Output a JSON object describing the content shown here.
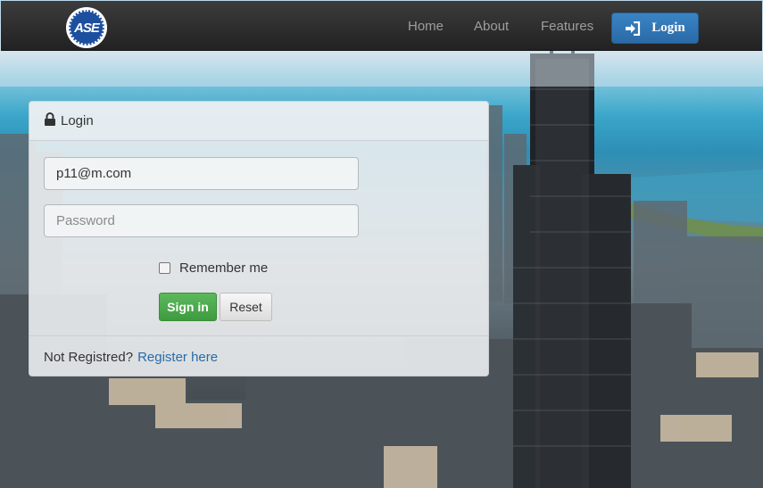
{
  "navbar": {
    "logo_text": "ASE",
    "links": {
      "home": "Home",
      "about": "About",
      "features": "Features"
    },
    "login_button": {
      "label": "Login",
      "icon": "sign-in-icon"
    }
  },
  "login_panel": {
    "title": "Login",
    "title_icon": "lock-icon",
    "email_value": "p11@m.com",
    "password_placeholder": "Password",
    "remember_label": "Remember me",
    "remember_checked": false,
    "signin_label": "Sign in",
    "reset_label": "Reset",
    "footer_text": "Not Registred?",
    "register_link": "Register here"
  },
  "colors": {
    "navbar_bg": "#222222",
    "primary": "#2a6aa6",
    "success": "#5cb85c",
    "nav_link": "#9d9d9d"
  }
}
